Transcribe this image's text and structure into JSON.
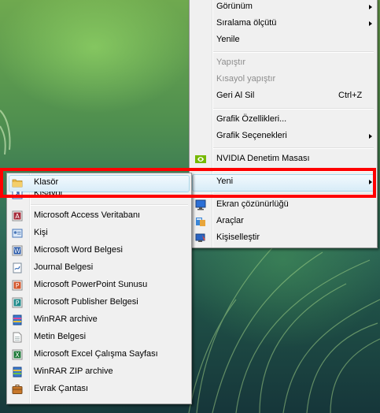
{
  "main_menu": {
    "items": [
      {
        "label": "Görünüm",
        "submenu": true
      },
      {
        "label": "Sıralama ölçütü",
        "submenu": true
      },
      {
        "label": "Yenile"
      },
      {
        "label": "Yapıştır",
        "disabled": true
      },
      {
        "label": "Kısayol yapıştır",
        "disabled": true
      },
      {
        "label": "Geri Al Sil",
        "shortcut": "Ctrl+Z"
      },
      {
        "label": "Grafik Özellikleri..."
      },
      {
        "label": "Grafik Seçenekleri",
        "submenu": true
      },
      {
        "label": "NVIDIA Denetim Masası",
        "icon": "nvidia-icon"
      },
      {
        "label": "Yeni",
        "submenu": true,
        "highlighted": true
      },
      {
        "label": "Ekran çözünürlüğü",
        "icon": "display-icon"
      },
      {
        "label": "Araçlar",
        "icon": "tools-icon"
      },
      {
        "label": "Kişiselleştir",
        "icon": "personalize-icon"
      }
    ]
  },
  "new_submenu": {
    "items": [
      {
        "label": "Klasör",
        "icon": "folder-icon",
        "highlighted": true
      },
      {
        "label": "Kısayol",
        "icon": "shortcut-icon"
      },
      {
        "label": "Microsoft Access Veritabanı",
        "icon": "access-icon"
      },
      {
        "label": "Kişi",
        "icon": "contact-icon"
      },
      {
        "label": "Microsoft Word Belgesi",
        "icon": "word-icon"
      },
      {
        "label": "Journal Belgesi",
        "icon": "journal-icon"
      },
      {
        "label": "Microsoft PowerPoint Sunusu",
        "icon": "powerpoint-icon"
      },
      {
        "label": "Microsoft Publisher Belgesi",
        "icon": "publisher-icon"
      },
      {
        "label": "WinRAR archive",
        "icon": "winrar-icon"
      },
      {
        "label": "Metin Belgesi",
        "icon": "text-document-icon"
      },
      {
        "label": "Microsoft Excel Çalışma Sayfası",
        "icon": "excel-icon"
      },
      {
        "label": "WinRAR ZIP archive",
        "icon": "winrar-zip-icon"
      },
      {
        "label": "Evrak Çantası",
        "icon": "briefcase-icon"
      }
    ]
  },
  "colors": {
    "highlight_border": "#a8d8eb",
    "annotation_frame": "#ff0000",
    "menu_background": "#f0f0f0"
  }
}
